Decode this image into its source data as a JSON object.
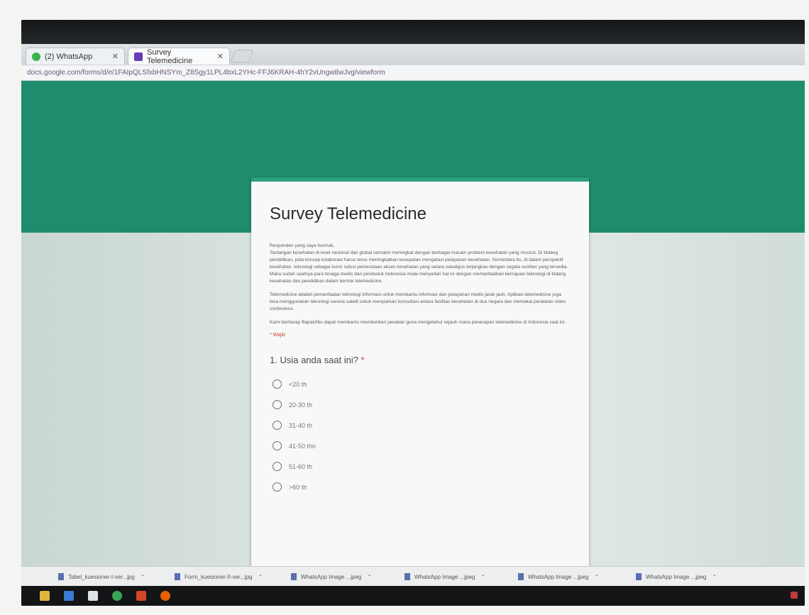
{
  "browser": {
    "tabs": [
      {
        "label": "(2) WhatsApp",
        "icon": "whatsapp-icon",
        "color": "#3bb34a"
      },
      {
        "label": "Survey Telemedicine",
        "icon": "google-forms-icon",
        "color": "#673ab7"
      }
    ],
    "url": "docs.google.com/forms/d/e/1FAIpQLSfxbHNSYm_Z8Sgy1LPL4bxL2YHc-FFJ6KRAH-4hY2vUngw8wJvg/viewform"
  },
  "form": {
    "accent_color": "#1f8c6e",
    "title": "Survey Telemedicine",
    "description": [
      "Responden yang saya hormati,",
      "Tantangan kesehatan di level nasional dan global semakin meningkat dengan berbagai macam problem kesehatan yang muncul. Di bidang pendidikan, pola konsep kolaborasi harus terus meningkatkan kecepatan mengatasi pelayanan kesehatan. Sementara itu, di dalam perspektif kesehatan, teknologi sebagai kunci solusi pemerataan akses kesehatan yang setara sekaligus terjangkau dengan segala sumber yang tersedia. Maka sudah saatnya para tenaga medis dan penduduk Indonesia mulai menyadari hal ini dengan memanfaatkan kemajuan teknologi di bidang kesehatan dan pendidikan dalam bentuk telemedicine.",
      "Telemedicine adalah pemanfaatan teknologi informasi untuk membantu informasi dan pelayanan medis jarak jauh. Aplikasi telemedicine juga bisa menggunakan teknologi sarana satelit untuk menyiarkan konsultasi antara fasilitas kesehatan di dua negara dan memakai peralatan video conference.",
      "Kami berharap Bapak/Ibu dapat membantu memberikan jawaban guna mengetahui sejauh mana penerapan telemedicine di Indonesia saat ini."
    ],
    "required_note": "* Wajib",
    "question": {
      "title": "1. Usia anda saat ini?",
      "required_mark": "*",
      "options": [
        "<20 th",
        "20-30 th",
        "31-40 th",
        "41-50 thn",
        "51-60 th",
        ">60 th"
      ]
    }
  },
  "downloads": [
    "Tabel_kuesioner-I-ver...jpg",
    "Form_kuesioner-II-ver...jpg",
    "WhatsApp Image ...jpeg",
    "WhatsApp Image ...jpeg",
    "WhatsApp Image ...jpeg",
    "WhatsApp Image ...jpeg"
  ],
  "taskbar_icons": [
    {
      "name": "file-explorer-icon",
      "color": "#e2b33c"
    },
    {
      "name": "store-icon",
      "color": "#3a7bd5"
    },
    {
      "name": "mail-icon",
      "color": "#dfe3e6"
    },
    {
      "name": "chrome-icon",
      "color": "#3aa655"
    },
    {
      "name": "office-icon",
      "color": "#d24726"
    },
    {
      "name": "firefox-icon",
      "color": "#e66000"
    }
  ]
}
